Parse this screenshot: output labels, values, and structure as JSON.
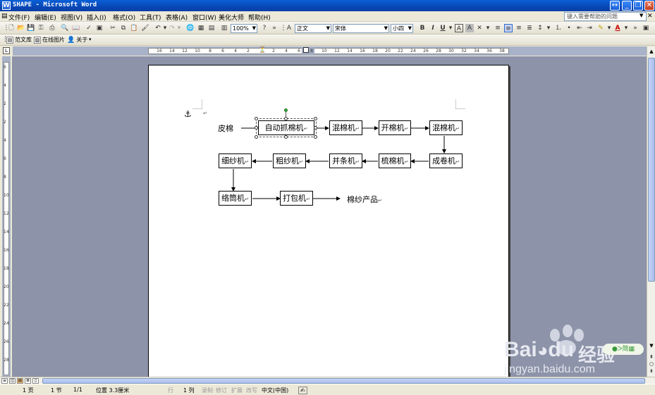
{
  "window": {
    "title": "SHAPE - Microsoft Word",
    "app_icon": "W",
    "help_placeholder": "键入需要帮助的问题"
  },
  "menu": [
    "文件(F)",
    "编辑(E)",
    "视图(V)",
    "插入(I)",
    "格式(O)",
    "工具(T)",
    "表格(A)",
    "窗口(W)",
    "美化大师",
    "帮助(H)"
  ],
  "toolbar": {
    "zoom": "100%",
    "style": "正文",
    "font": "宋体",
    "size": "小四",
    "bold": "B",
    "italic": "I",
    "underline": "U",
    "font_color_label": "A"
  },
  "toolbar2": {
    "items": [
      "范文库",
      "在线图片",
      "关于"
    ]
  },
  "ruler": {
    "h_labels": [
      "16",
      "14",
      "12",
      "10",
      "8",
      "6",
      "4",
      "2",
      "2",
      "4",
      "6",
      "8",
      "10",
      "12",
      "14",
      "16",
      "18",
      "20",
      "22",
      "24",
      "26",
      "28",
      "30",
      "32",
      "34",
      "36",
      "38"
    ],
    "v_labels": [
      "6",
      "4",
      "2",
      "2",
      "4",
      "6",
      "8",
      "10",
      "12",
      "14",
      "16",
      "18",
      "20",
      "22",
      "24",
      "26",
      "28"
    ]
  },
  "flowchart": {
    "start_label": "皮棉",
    "row1": [
      "自动抓棉机",
      "混棉机",
      "开棉机",
      "混棉机"
    ],
    "row2": [
      "成卷机",
      "梳棉机",
      "并条机",
      "粗纱机",
      "细纱机"
    ],
    "row3": [
      "络筒机",
      "打包机"
    ],
    "end_label": "棉纱产品",
    "paragraph_mark": "↵"
  },
  "status": {
    "page": "1 页",
    "section": "1 节",
    "page_of": "1/1",
    "position": "位置 3.3厘米",
    "line": "行",
    "column": "1 列",
    "rec": "录制",
    "trk": "修订",
    "ext": "扩展",
    "ovr": "改写",
    "language": "中文(中国)"
  },
  "watermark": {
    "brand": "Bai",
    "brand2": "du",
    "jingyan": "经验",
    "url": "jingyan.baidu.com"
  },
  "colors": {
    "title_bar": "#0747b5",
    "canvas": "#8d93a8",
    "page": "#ffffff",
    "selection_handle": "#33a633"
  }
}
